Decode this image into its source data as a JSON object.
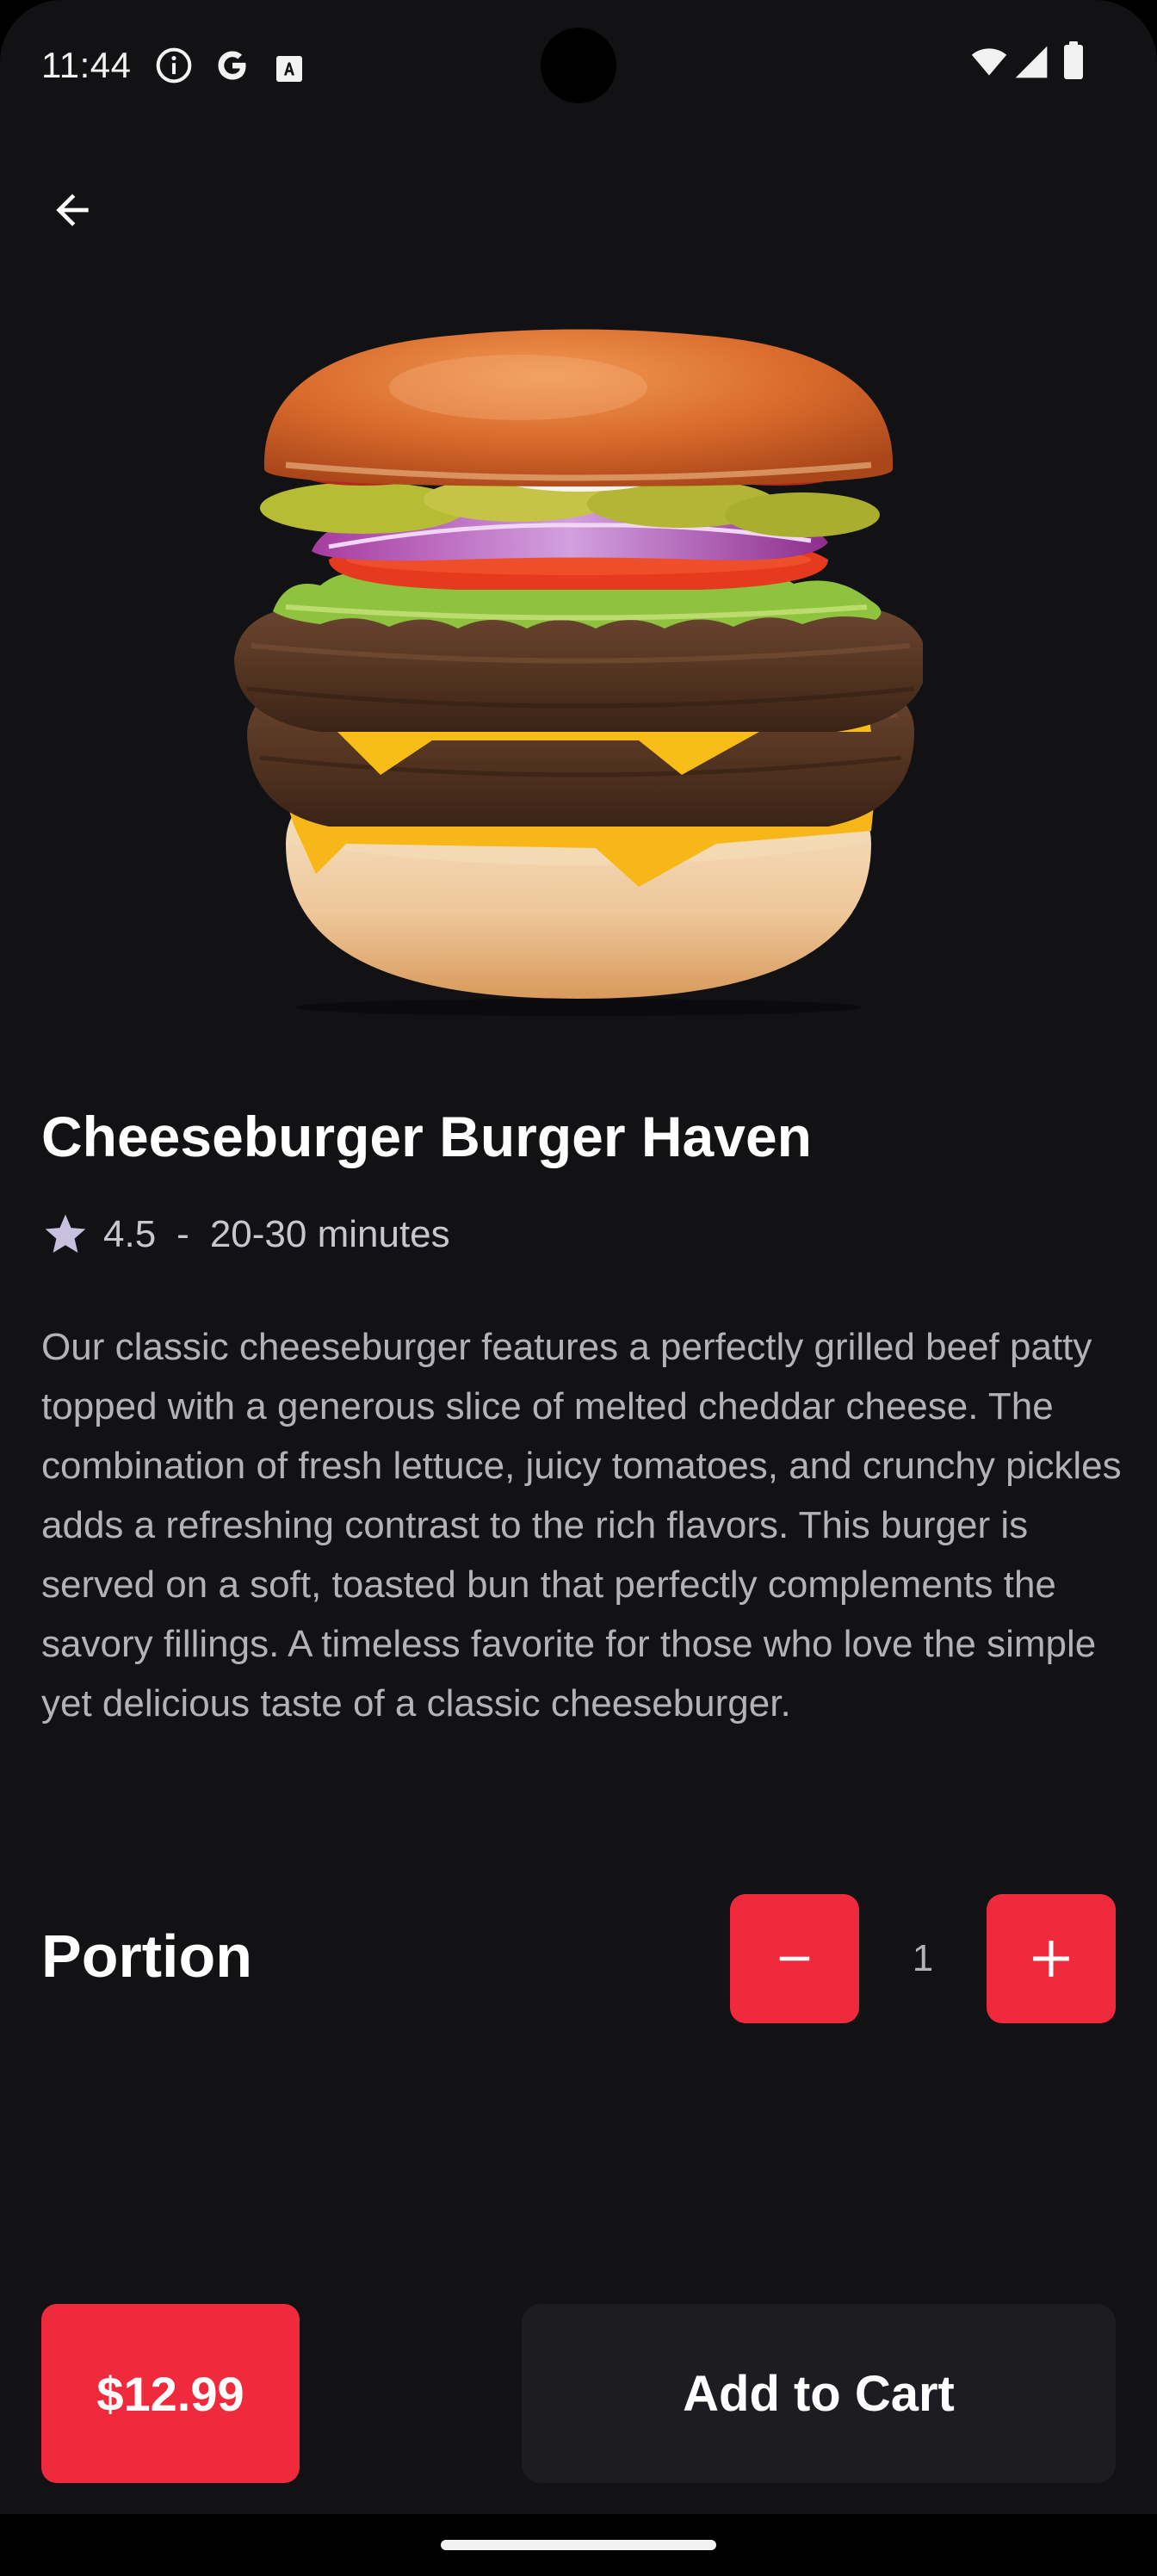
{
  "status_bar": {
    "time": "11:44",
    "left_icons": [
      "info-icon",
      "google-icon",
      "font-icon"
    ],
    "right_icons": [
      "wifi-icon",
      "signal-icon",
      "battery-icon"
    ]
  },
  "header": {
    "back_icon": "arrow-back-icon"
  },
  "product": {
    "image_label": "cheeseburger",
    "title": "Cheeseburger Burger Haven",
    "rating": "4.5",
    "separator": "-",
    "delivery_time": "20-30 minutes",
    "description": "Our classic cheeseburger features a perfectly grilled beef patty topped with a generous slice of melted cheddar cheese. The combination of fresh lettuce, juicy tomatoes, and crunchy pickles adds a refreshing contrast to the rich flavors. This burger is served on a soft, toasted bun that perfectly complements the savory fillings. A timeless favorite for those who love the simple yet delicious taste of a classic cheeseburger."
  },
  "portion": {
    "label": "Portion",
    "quantity": "1",
    "decrement_icon": "minus-icon",
    "increment_icon": "plus-icon"
  },
  "actions": {
    "price": "$12.99",
    "add_to_cart_label": "Add to Cart"
  },
  "colors": {
    "accent": "#ee2a3c",
    "background": "#121114",
    "surface": "#1d1c21",
    "text_primary": "#ffffff",
    "text_secondary": "#b4b1b8"
  }
}
